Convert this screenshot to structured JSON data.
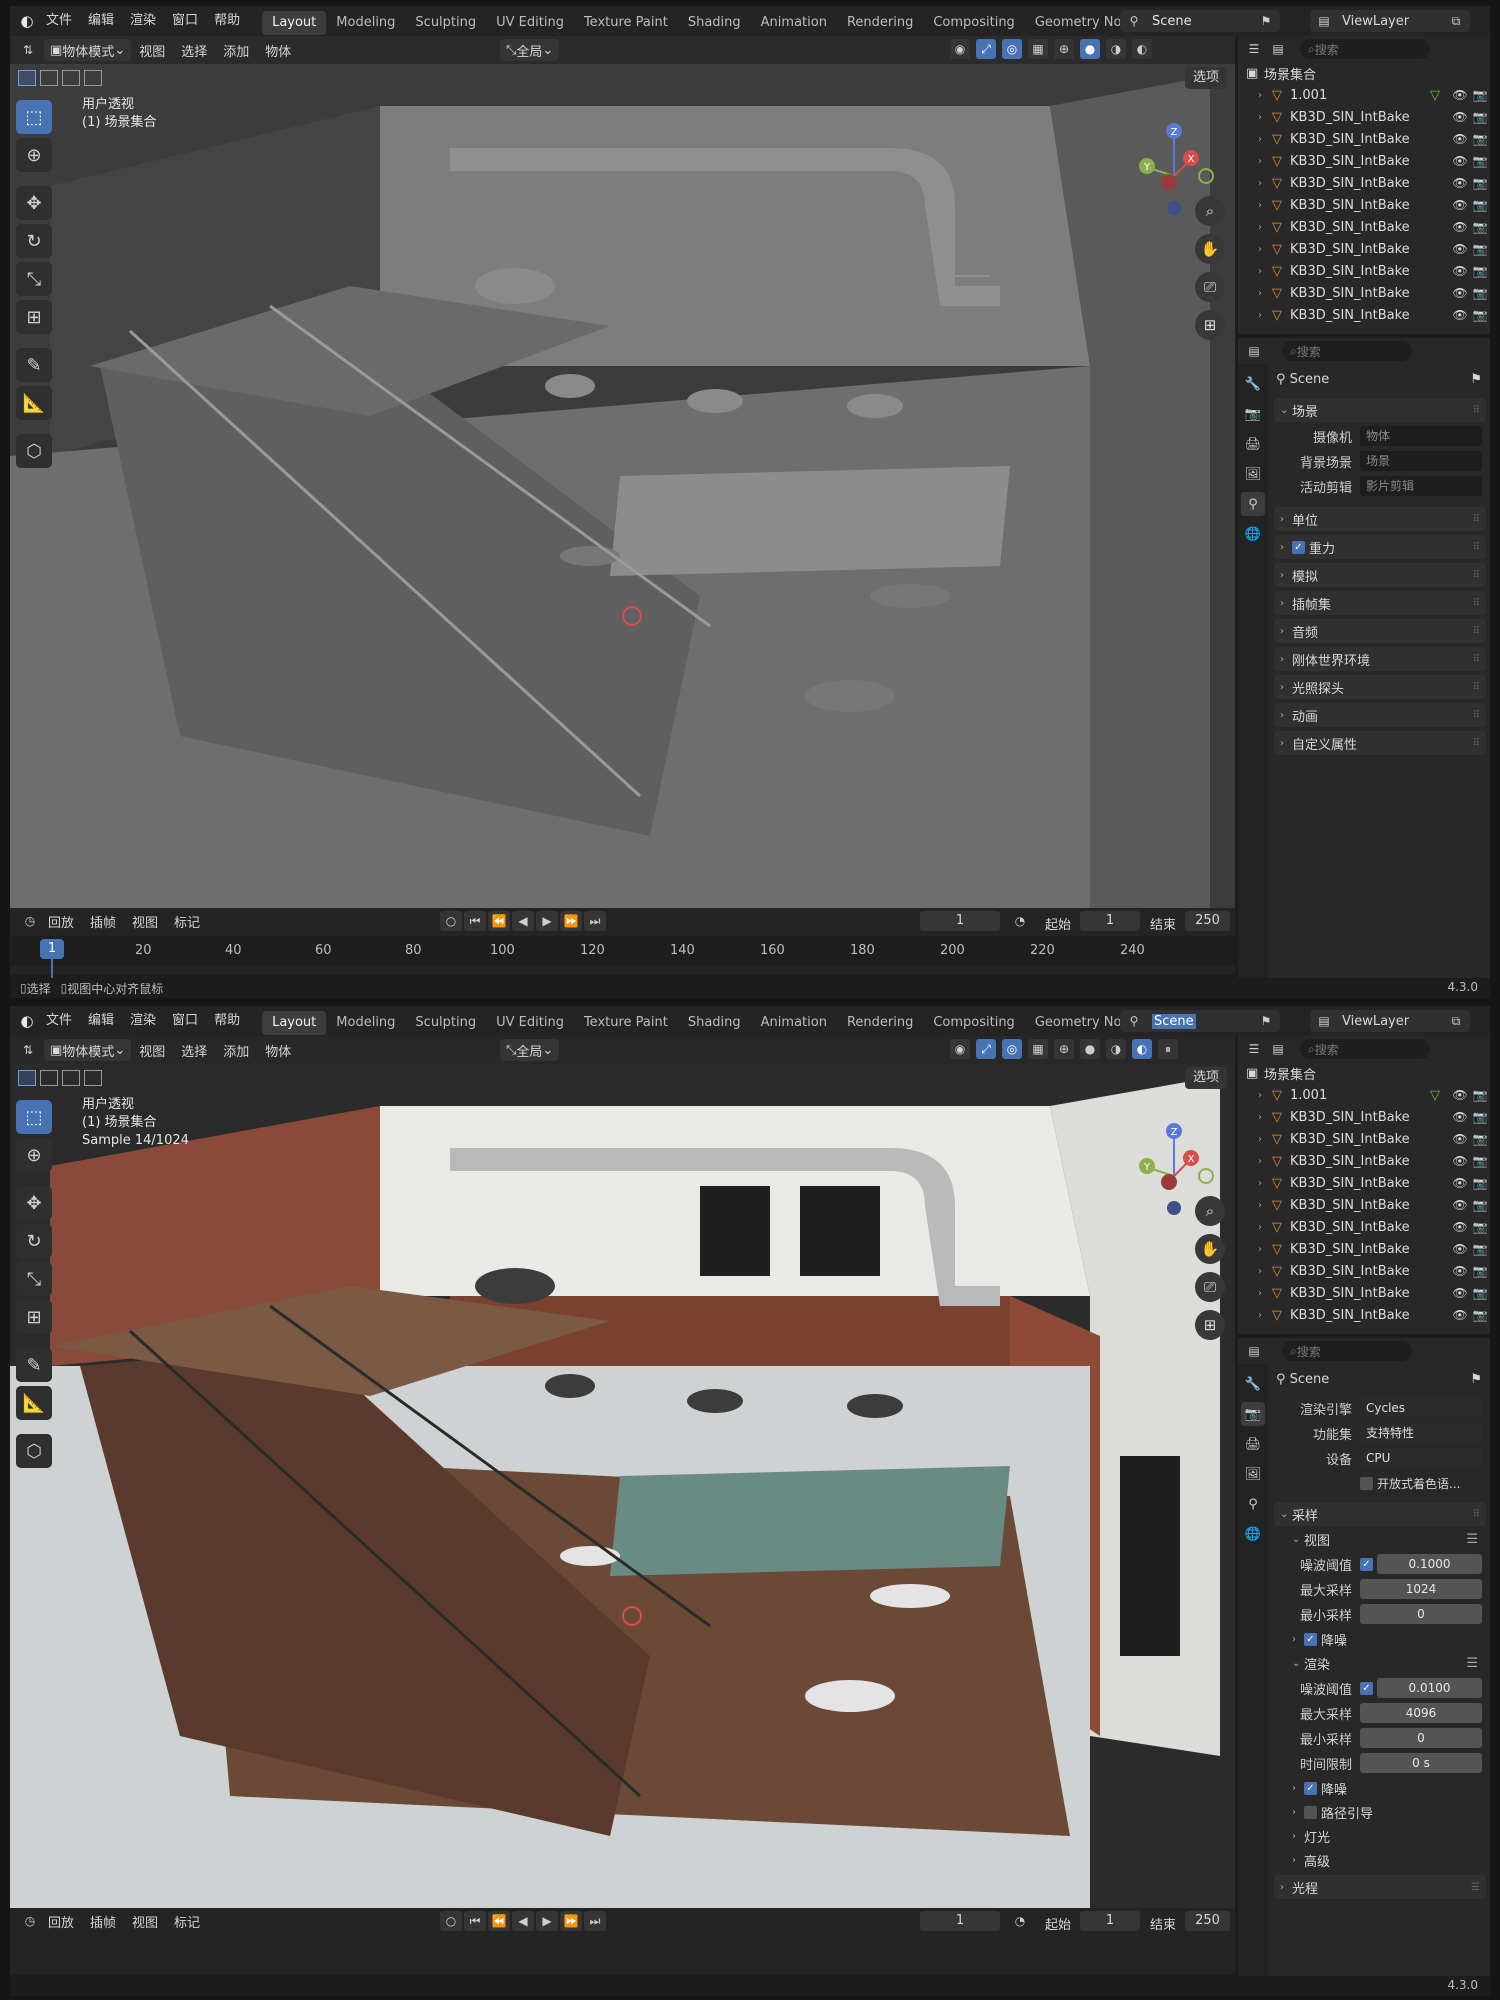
{
  "top_menu": [
    "文件",
    "编辑",
    "渲染",
    "窗口",
    "帮助"
  ],
  "workspace_tabs": [
    "Layout",
    "Modeling",
    "Sculpting",
    "UV Editing",
    "Texture Paint",
    "Shading",
    "Animation",
    "Rendering",
    "Compositing",
    "Geometry Nodes"
  ],
  "active_workspace": "Layout",
  "scene_name": "Scene",
  "view_layer": "ViewLayer",
  "viewport": {
    "mode": "物体模式",
    "menus": [
      "视图",
      "选择",
      "添加",
      "物体"
    ],
    "orientation": "全局",
    "options_label": "选项",
    "info_line1": "用户透视",
    "info_line2": "(1) 场景集合",
    "sample_text": "Sample 14/1024"
  },
  "gizmo_axes": {
    "z": "Z",
    "y": "Y",
    "x": "X"
  },
  "timeline": {
    "menus": [
      "回放",
      "插帧",
      "视图",
      "标记"
    ],
    "current_frame": "1",
    "start_label": "起始",
    "start": "1",
    "end_label": "结束",
    "end": "250",
    "ticks": [
      "20",
      "40",
      "60",
      "80",
      "100",
      "120",
      "140",
      "160",
      "180",
      "200",
      "220",
      "240"
    ],
    "ruler_frame": "1"
  },
  "status": {
    "select": "选择",
    "center": "视图中心对齐鼠标",
    "version": "4.3.0"
  },
  "outliner": {
    "search_placeholder": "搜索",
    "collection": "场景集合",
    "items": [
      "1.001",
      "KB3D_SIN_IntBake",
      "KB3D_SIN_IntBake",
      "KB3D_SIN_IntBake",
      "KB3D_SIN_IntBake",
      "KB3D_SIN_IntBake",
      "KB3D_SIN_IntBake",
      "KB3D_SIN_IntBake",
      "KB3D_SIN_IntBake",
      "KB3D_SIN_IntBake",
      "KB3D_SIN_IntBake"
    ]
  },
  "props_scene": {
    "search_placeholder": "搜索",
    "title": "Scene",
    "panel": "场景",
    "camera_label": "摄像机",
    "camera_value": "物体",
    "bg_label": "背景场景",
    "bg_value": "场景",
    "clip_label": "活动剪辑",
    "clip_value": "影片剪辑",
    "panels": [
      "单位",
      "重力",
      "模拟",
      "插帧集",
      "音频",
      "刚体世界环境",
      "光照探头",
      "动画",
      "自定义属性"
    ]
  },
  "props_render": {
    "search_placeholder": "搜索",
    "title": "Scene",
    "engine_label": "渲染引擎",
    "engine": "Cycles",
    "feature_label": "功能集",
    "feature": "支持特性",
    "device_label": "设备",
    "device": "CPU",
    "osl": "开放式着色语...",
    "sampling": "采样",
    "viewport_sub": "视图",
    "noise_label": "噪波阈值",
    "vp_noise": "0.1000",
    "max_label": "最大采样",
    "vp_max": "1024",
    "min_label": "最小采样",
    "vp_min": "0",
    "denoise": "降噪",
    "render_sub": "渲染",
    "r_noise": "0.0100",
    "r_max": "4096",
    "r_min": "0",
    "time_label": "时间限制",
    "time_value": "0 s",
    "r_denoise": "降噪",
    "path_guiding": "路径引导",
    "lights": "灯光",
    "advanced": "高级",
    "light_paths": "光程"
  },
  "colors": {
    "accent": "#4772b3",
    "object_orange": "#e08a2c"
  }
}
